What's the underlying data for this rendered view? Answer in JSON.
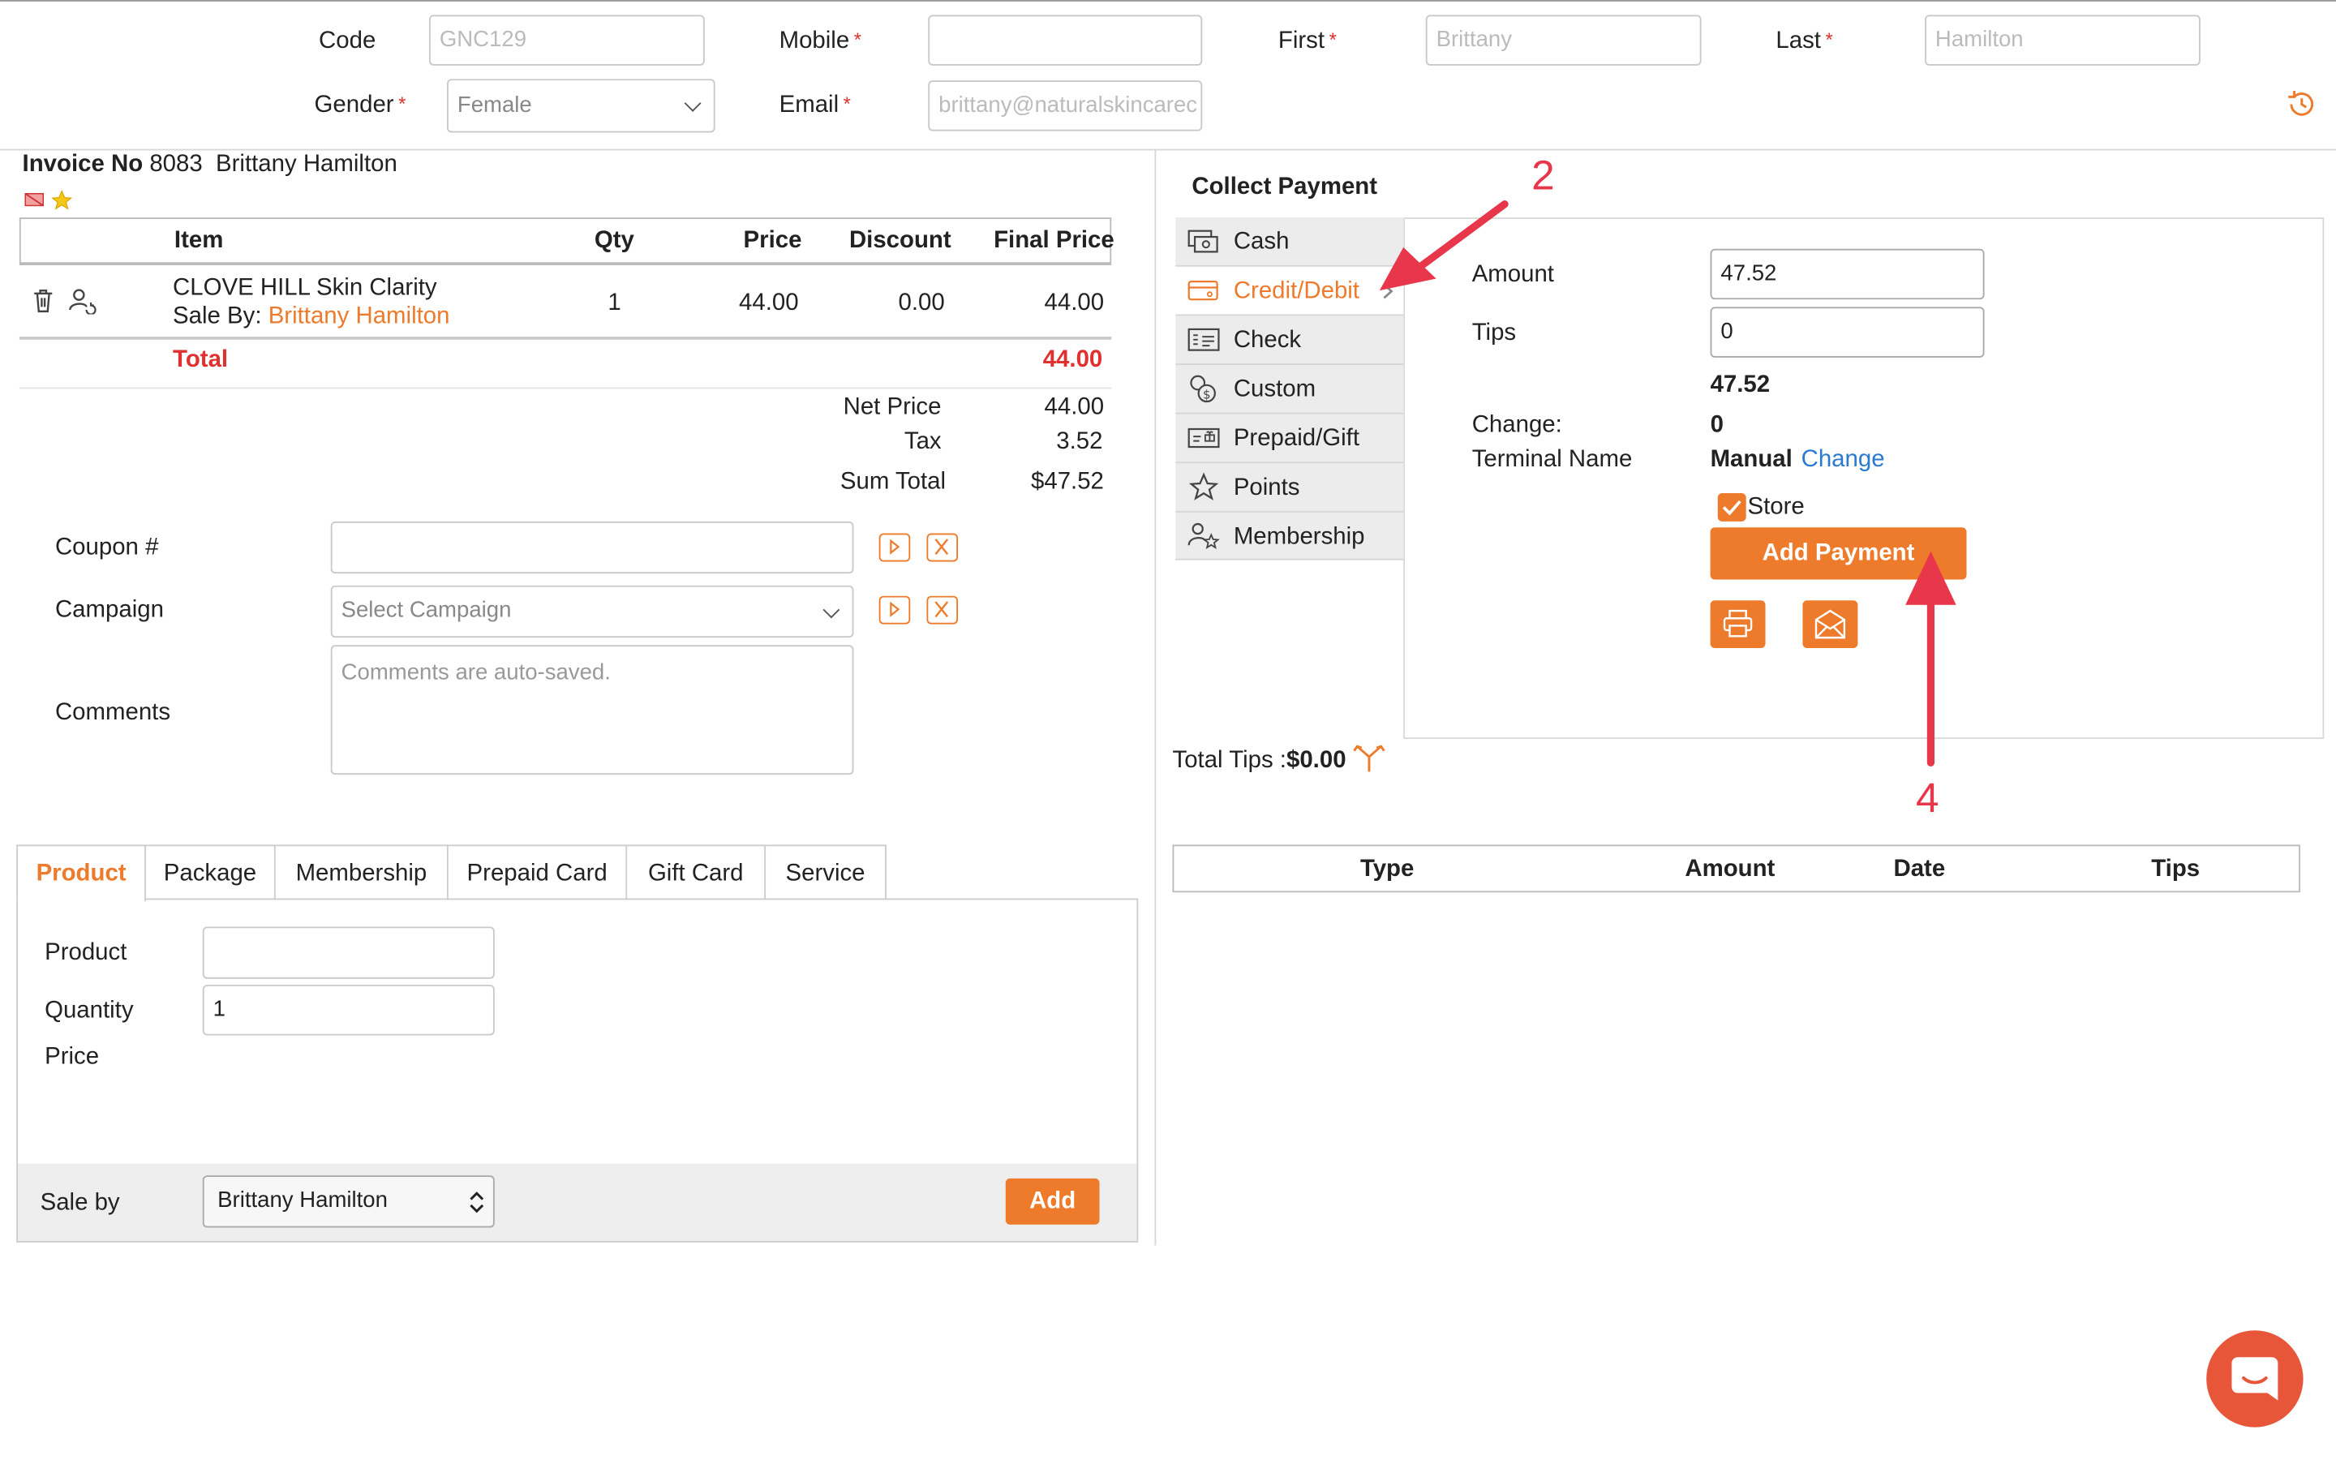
{
  "header": {
    "code_label": "Code",
    "code_value": "GNC129",
    "mobile_label": "Mobile",
    "mobile_value": "",
    "first_label": "First",
    "first_value": "Brittany",
    "last_label": "Last",
    "last_value": "Hamilton",
    "gender_label": "Gender",
    "gender_value": "Female",
    "email_label": "Email",
    "email_value": "brittany@naturalskincarec",
    "required_mark": "*"
  },
  "invoice": {
    "label": "Invoice No",
    "number": "8083",
    "customer": "Brittany Hamilton",
    "columns": [
      "Item",
      "Qty",
      "Price",
      "Discount",
      "Final Price"
    ],
    "item": {
      "name": "CLOVE HILL Skin Clarity",
      "sale_by_label": "Sale By:",
      "sale_by": "Brittany Hamilton",
      "qty": "1",
      "price": "44.00",
      "discount": "0.00",
      "final_price": "44.00"
    },
    "total_label": "Total",
    "total_value": "44.00",
    "net_price_label": "Net Price",
    "net_price_value": "44.00",
    "tax_label": "Tax",
    "tax_value": "3.52",
    "sum_total_label": "Sum Total",
    "sum_total_value": "$47.52"
  },
  "form": {
    "coupon_label": "Coupon #",
    "coupon_value": "",
    "campaign_label": "Campaign",
    "campaign_placeholder": "Select Campaign",
    "comments_label": "Comments",
    "comments_placeholder": "Comments are auto-saved."
  },
  "tabs": [
    "Product",
    "Package",
    "Membership",
    "Prepaid Card",
    "Gift Card",
    "Service"
  ],
  "product_form": {
    "product_label": "Product",
    "product_value": "",
    "quantity_label": "Quantity",
    "quantity_value": "1",
    "price_label": "Price",
    "sale_by_label": "Sale by",
    "sale_by_value": "Brittany Hamilton",
    "add_label": "Add"
  },
  "payment": {
    "title": "Collect Payment",
    "methods": [
      "Cash",
      "Credit/Debit",
      "Check",
      "Custom",
      "Prepaid/Gift",
      "Points",
      "Membership"
    ],
    "selected_method": "Credit/Debit",
    "amount_label": "Amount",
    "amount_value": "47.52",
    "tips_label": "Tips",
    "tips_value": "0",
    "total_value": "47.52",
    "change_label": "Change:",
    "change_value": "0",
    "terminal_label": "Terminal Name",
    "terminal_value": "Manual",
    "terminal_change": "Change",
    "store_label": "Store",
    "store_checked": true,
    "add_payment_label": "Add Payment",
    "total_tips_label": "Total Tips :",
    "total_tips_value": "$0.00"
  },
  "payments_table": {
    "columns": [
      "Type",
      "Amount",
      "Date",
      "Tips"
    ]
  },
  "annotations": {
    "arrow_2_label": "2",
    "arrow_4_label": "4"
  },
  "colors": {
    "accent": "#ee7a2b",
    "required": "#e03030",
    "link": "#2a7ad0",
    "annotation": "#e8374a"
  }
}
